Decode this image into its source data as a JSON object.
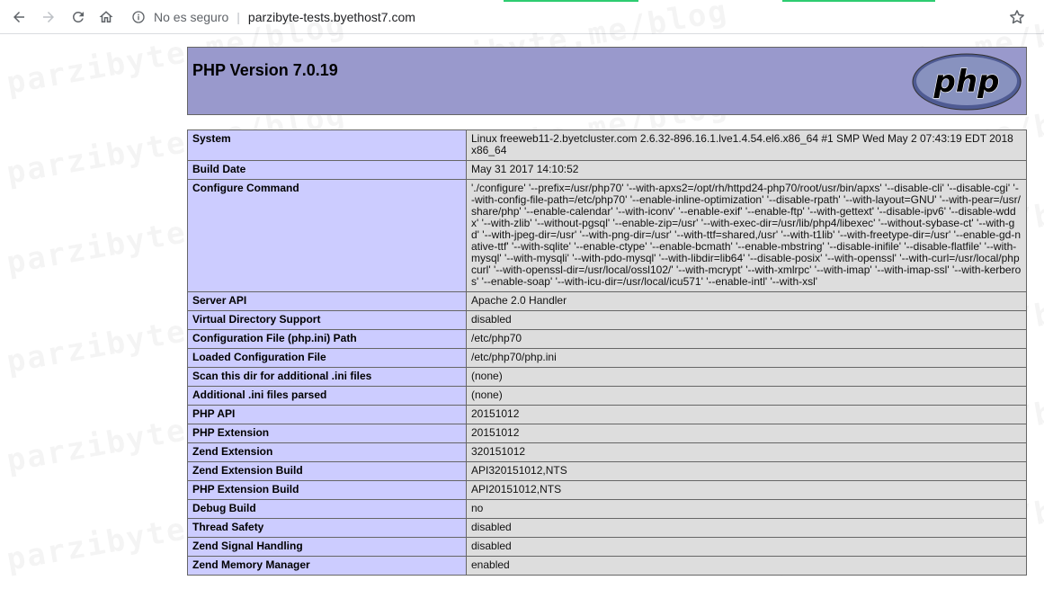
{
  "browser": {
    "security_label": "No es seguro",
    "url": "parzibyte-tests.byethost7.com",
    "watermark": "parzibyte.me/blog"
  },
  "php": {
    "title": "PHP Version 7.0.19",
    "logo_text": "php"
  },
  "rows": [
    {
      "key": "System",
      "value": "Linux freeweb11-2.byetcluster.com 2.6.32-896.16.1.lve1.4.54.el6.x86_64 #1 SMP Wed May 2 07:43:19 EDT 2018 x86_64"
    },
    {
      "key": "Build Date",
      "value": "May 31 2017 14:10:52"
    },
    {
      "key": "Configure Command",
      "value": "'./configure' '--prefix=/usr/php70' '--with-apxs2=/opt/rh/httpd24-php70/root/usr/bin/apxs' '--disable-cli' '--disable-cgi' '--with-config-file-path=/etc/php70' '--enable-inline-optimization' '--disable-rpath' '--with-layout=GNU' '--with-pear=/usr/share/php' '--enable-calendar' '--with-iconv' '--enable-exif' '--enable-ftp' '--with-gettext' '--disable-ipv6' '--disable-wddx' '--with-zlib' '--without-pgsql' '--enable-zip=/usr' '--with-exec-dir=/usr/lib/php4/libexec' '--without-sybase-ct' '--with-gd' '--with-jpeg-dir=/usr' '--with-png-dir=/usr' '--with-ttf=shared,/usr' '--with-t1lib' '--with-freetype-dir=/usr' '--enable-gd-native-ttf' '--with-sqlite' '--enable-ctype' '--enable-bcmath' '--enable-mbstring' '--disable-inifile' '--disable-flatfile' '--with-mysql' '--with-mysqli' '--with-pdo-mysql' '--with-libdir=lib64' '--disable-posix' '--with-openssl' '--with-curl=/usr/local/phpcurl' '--with-openssl-dir=/usr/local/ossl102/' '--with-mcrypt' '--with-xmlrpc' '--with-imap' '--with-imap-ssl' '--with-kerberos' '--enable-soap' '--with-icu-dir=/usr/local/icu571' '--enable-intl' '--with-xsl'"
    },
    {
      "key": "Server API",
      "value": "Apache 2.0 Handler"
    },
    {
      "key": "Virtual Directory Support",
      "value": "disabled"
    },
    {
      "key": "Configuration File (php.ini) Path",
      "value": "/etc/php70"
    },
    {
      "key": "Loaded Configuration File",
      "value": "/etc/php70/php.ini"
    },
    {
      "key": "Scan this dir for additional .ini files",
      "value": "(none)"
    },
    {
      "key": "Additional .ini files parsed",
      "value": "(none)"
    },
    {
      "key": "PHP API",
      "value": "20151012"
    },
    {
      "key": "PHP Extension",
      "value": "20151012"
    },
    {
      "key": "Zend Extension",
      "value": "320151012"
    },
    {
      "key": "Zend Extension Build",
      "value": "API320151012,NTS"
    },
    {
      "key": "PHP Extension Build",
      "value": "API20151012,NTS"
    },
    {
      "key": "Debug Build",
      "value": "no"
    },
    {
      "key": "Thread Safety",
      "value": "disabled"
    },
    {
      "key": "Zend Signal Handling",
      "value": "disabled"
    },
    {
      "key": "Zend Memory Manager",
      "value": "enabled"
    }
  ]
}
